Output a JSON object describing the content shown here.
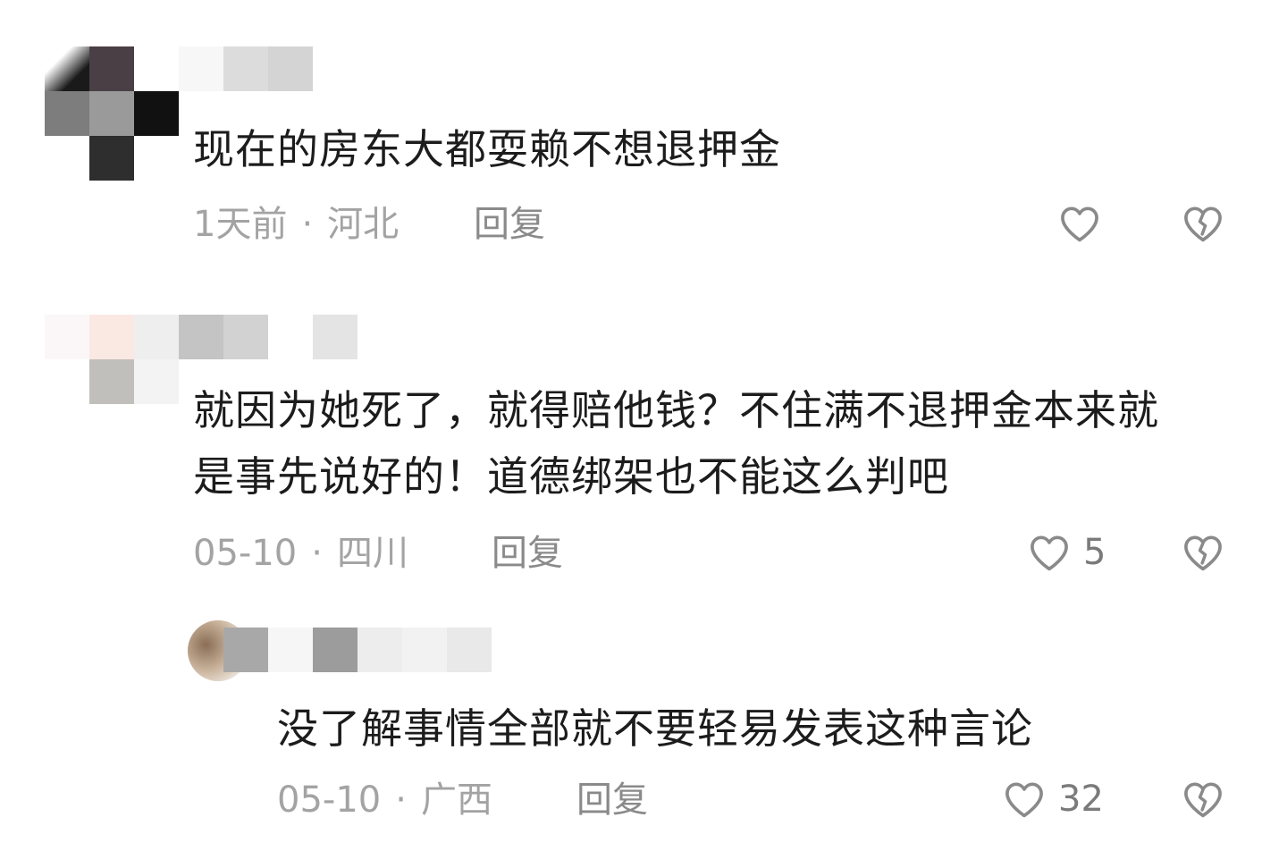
{
  "comments": [
    {
      "text": "现在的房东大都耍赖不想退押金",
      "time": "1天前",
      "location": "河北",
      "reply_label": "回复",
      "likes": ""
    },
    {
      "text_line1": "就因为她死了，就得赔他钱？不住满不退押金本来就",
      "text_line2": "是事先说好的！道德绑架也不能这么判吧",
      "time": "05-10",
      "location": "四川",
      "reply_label": "回复",
      "likes": "5"
    },
    {
      "text": "没了解事情全部就不要轻易发表这种言论",
      "time": "05-10",
      "location": "广西",
      "reply_label": "回复",
      "likes": "32"
    }
  ],
  "separator": "·",
  "colors": {
    "text": "#1c1c1c",
    "meta": "#a3a3a3",
    "icon": "#8a8a8a"
  },
  "icons": {
    "like": "heart-outline-icon",
    "dislike": "broken-heart-icon"
  }
}
